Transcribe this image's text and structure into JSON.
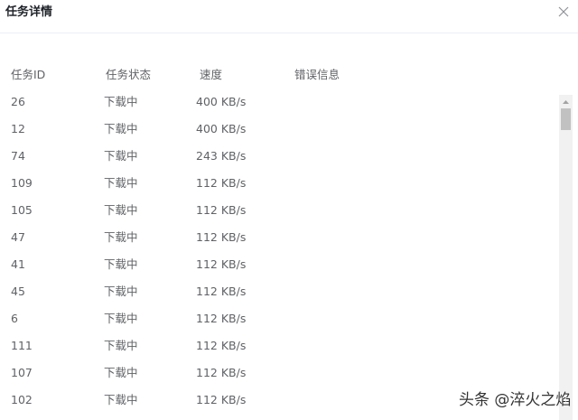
{
  "dialog": {
    "title": "任务详情",
    "close_icon": "close-icon"
  },
  "table": {
    "headers": {
      "id": "任务ID",
      "status": "任务状态",
      "speed": "速度",
      "error": "错误信息"
    },
    "rows": [
      {
        "id": "26",
        "status": "下载中",
        "speed": "400 KB/s",
        "error": ""
      },
      {
        "id": "12",
        "status": "下载中",
        "speed": "400 KB/s",
        "error": ""
      },
      {
        "id": "74",
        "status": "下载中",
        "speed": "243 KB/s",
        "error": ""
      },
      {
        "id": "109",
        "status": "下载中",
        "speed": "112 KB/s",
        "error": ""
      },
      {
        "id": "105",
        "status": "下载中",
        "speed": "112 KB/s",
        "error": ""
      },
      {
        "id": "47",
        "status": "下载中",
        "speed": "112 KB/s",
        "error": ""
      },
      {
        "id": "41",
        "status": "下载中",
        "speed": "112 KB/s",
        "error": ""
      },
      {
        "id": "45",
        "status": "下载中",
        "speed": "112 KB/s",
        "error": ""
      },
      {
        "id": "6",
        "status": "下载中",
        "speed": "112 KB/s",
        "error": ""
      },
      {
        "id": "111",
        "status": "下载中",
        "speed": "112 KB/s",
        "error": ""
      },
      {
        "id": "107",
        "status": "下载中",
        "speed": "112 KB/s",
        "error": ""
      },
      {
        "id": "102",
        "status": "下载中",
        "speed": "112 KB/s",
        "error": ""
      }
    ]
  },
  "watermark": "头条 @淬火之焰",
  "colors": {
    "text": "#606266",
    "title": "#1f2329",
    "divider": "#ebeef5",
    "scroll_track": "#f1f1f1",
    "scroll_thumb": "#c1c1c1"
  }
}
